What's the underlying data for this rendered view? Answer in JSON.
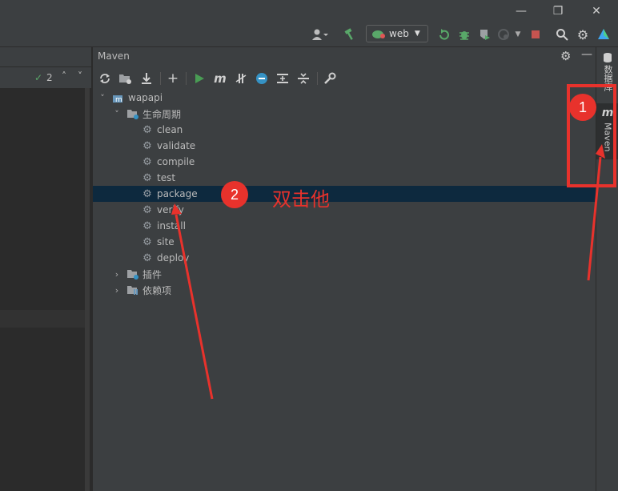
{
  "titlebar": {
    "minimize_icon": "minimize-icon",
    "restore_icon": "restore-icon",
    "close_icon": "close-icon"
  },
  "toolbar": {
    "run_config_label": "web",
    "icons": [
      "user-icon",
      "build-hammer-icon",
      "rerun-icon",
      "debug-icon",
      "coverage-icon",
      "profile-icon",
      "stop-icon",
      "search-icon",
      "settings-icon",
      "toolbox-icon"
    ]
  },
  "editor": {
    "problems_count": "2"
  },
  "maven": {
    "title": "Maven",
    "toolbar_icons": [
      "reload-icon",
      "add-folder-icon",
      "download-icon",
      "plus-icon",
      "run-icon",
      "maven-m-icon",
      "toggle-offline-icon",
      "skip-tests-icon",
      "show-dependencies-icon",
      "collapse-icon",
      "tool-settings-icon"
    ],
    "tree": {
      "project": "wapapi",
      "lifecycle_label": "生命周期",
      "lifecycle": [
        "clean",
        "validate",
        "compile",
        "test",
        "package",
        "verify",
        "install",
        "site",
        "deploy"
      ],
      "plugins_label": "插件",
      "dependencies_label": "依赖项",
      "selected": "package"
    }
  },
  "right_strip": {
    "database_label": "数据库",
    "maven_label": "Maven"
  },
  "annotations": {
    "badge1": "1",
    "badge2": "2",
    "instruction": "双击他",
    "color": "#e8322c"
  }
}
